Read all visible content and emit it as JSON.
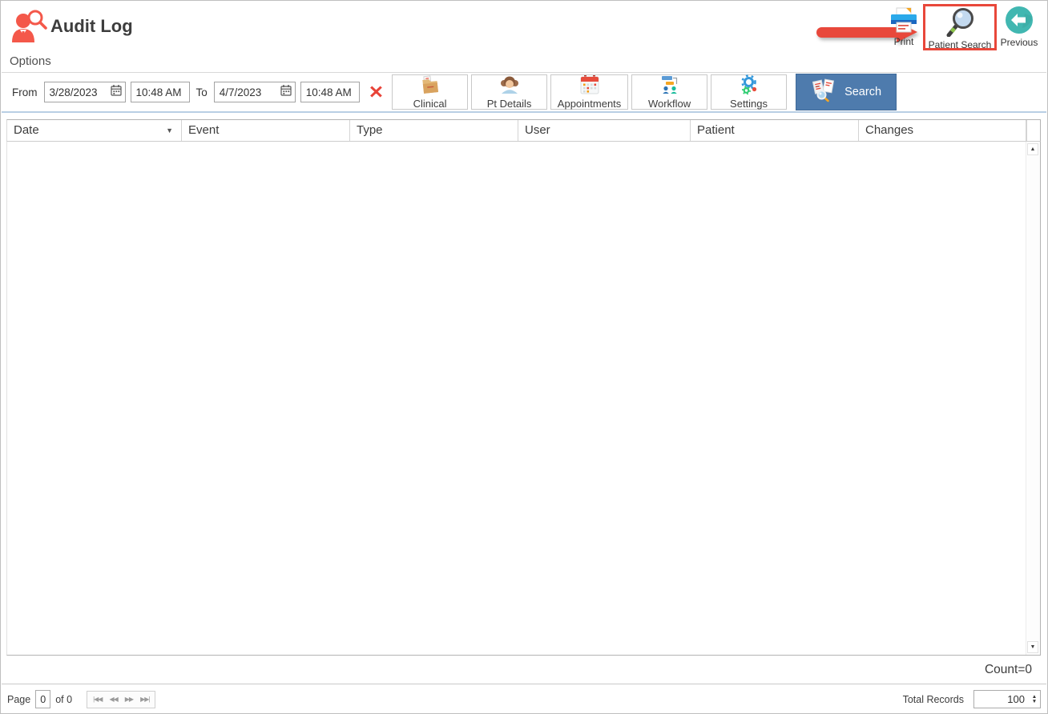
{
  "window": {
    "title": "Audit Log",
    "menu": {
      "options_label": "Options"
    }
  },
  "header_actions": {
    "print_label": "Print",
    "patient_search_label": "Patient Search",
    "previous_label": "Previous"
  },
  "filters": {
    "from_label": "From",
    "from_date": "3/28/2023",
    "from_time": "10:48 AM",
    "to_label": "To",
    "to_date": "4/7/2023",
    "to_time": "10:48 AM",
    "clear_glyph": "✕"
  },
  "toolbar": {
    "buttons": [
      {
        "label": "Clinical"
      },
      {
        "label": "Pt Details"
      },
      {
        "label": "Appointments"
      },
      {
        "label": "Workflow"
      },
      {
        "label": "Settings"
      }
    ],
    "search_label": "Search"
  },
  "table": {
    "columns": [
      {
        "label": "Date"
      },
      {
        "label": "Event"
      },
      {
        "label": "Type"
      },
      {
        "label": "User"
      },
      {
        "label": "Patient"
      },
      {
        "label": "Changes"
      }
    ],
    "rows": [],
    "count_text": "Count=0"
  },
  "status_bar": {
    "page_label": "Page",
    "page_value": "0",
    "of_label": "of 0",
    "total_records_label": "Total Records",
    "total_records_value": "100"
  },
  "glyphs": {
    "sort_down": "▼",
    "scroll_up": "▲",
    "scroll_down": "▼",
    "spin_up": "▲",
    "spin_down": "▼",
    "nav_first": "|◀◀",
    "nav_prev": "◀◀",
    "nav_next": "▶▶",
    "nav_last": "▶▶|"
  },
  "icons": {
    "app": "person-with-magnifier-icon",
    "print": "printer-icon",
    "patient_search": "magnifier-icon",
    "previous": "left-arrow-circle-icon",
    "calendar": "calendar-icon",
    "clinical": "folder-icon",
    "pt_details": "person-icon",
    "appointments": "calendar-grid-icon",
    "workflow": "flowchart-people-icon",
    "settings": "gears-icon",
    "search": "documents-magnifier-icon"
  },
  "colors": {
    "accent_red": "#e8483b",
    "search_blue": "#4e7bad",
    "previous_teal": "#41b7b1",
    "highlight_border": "#e8473a",
    "filter_underline": "#b9cfe4"
  }
}
